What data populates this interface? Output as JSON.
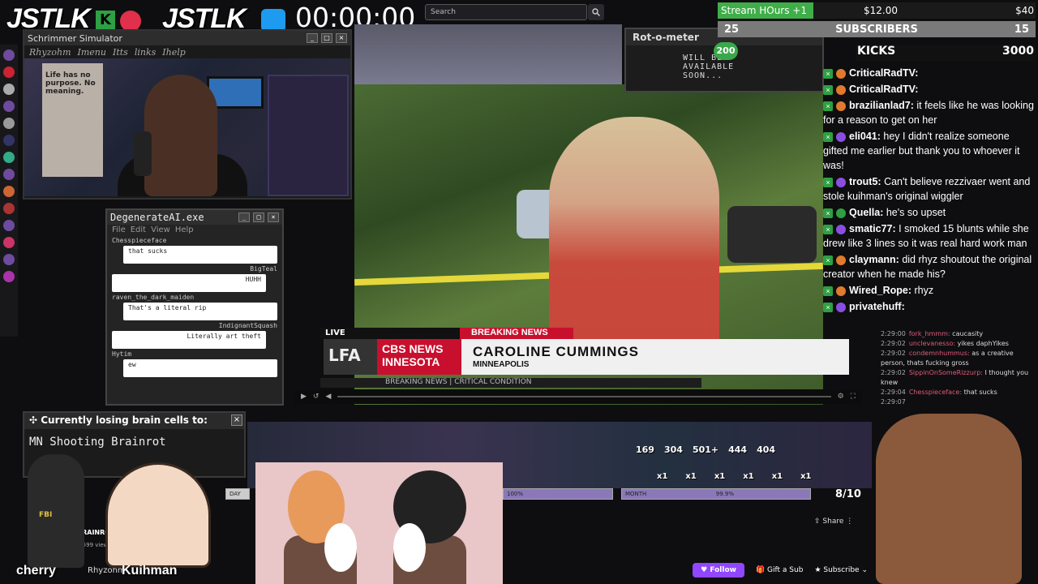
{
  "header": {
    "logo_left": "JSTLK",
    "logo_right": "JSTLK_",
    "timer": "00:00:00",
    "search_placeholder": "Search"
  },
  "goals": {
    "stream_hours_label": "Stream HOurs +1",
    "stream_hours_current": "$12.00",
    "stream_hours_target": "$40",
    "stream_hours_fraction": 0.3,
    "subs_current": "25",
    "subs_label": "SUBSCRIBERS",
    "subs_target": "15",
    "kicks_label": "KICKS",
    "kicks_value": "3000"
  },
  "rot_meter": {
    "title": "Rot-o-meter",
    "message": "WILL BE AVAILABLE SOON...",
    "badge": "200"
  },
  "webcam_window": {
    "title": "Schrimmer Simulator",
    "menu": [
      "Rhyzohm",
      "Imenu",
      "Itts",
      "links",
      "Ihelp"
    ],
    "poster_text": "Life has no purpose. No meaning."
  },
  "chat": [
    {
      "user": "CriticalRadTV:",
      "text": "",
      "color": "#e07a2c"
    },
    {
      "user": "CriticalRadTV:",
      "text": "",
      "color": "#e07a2c"
    },
    {
      "user": "brazilianlad7:",
      "text": "it feels like he was looking for a reason to get on her",
      "color": "#e07a2c"
    },
    {
      "user": "eli041:",
      "text": "hey I didn't realize someone gifted me earlier but thank you to whoever it was!",
      "color": "#8a4fe0"
    },
    {
      "user": "trout5:",
      "text": "Can't believe rezzivaer went and stole kuihman's original wiggler",
      "color": "#8a4fe0"
    },
    {
      "user": "Quella:",
      "text": "he's so upset",
      "color": "#2ea043"
    },
    {
      "user": "smatic77:",
      "text": "I smoked 15 blunts while she drew like 3 lines so it was real hard work man",
      "color": "#8a4fe0"
    },
    {
      "user": "claymann:",
      "text": "did rhyz shoutout the original creator when he made his?",
      "color": "#e07a2c"
    },
    {
      "user": "Wired_Rope:",
      "text": "rhyz",
      "color": "#e07a2c"
    },
    {
      "user": "privatehuff:",
      "text": "",
      "color": "#8a4fe0"
    }
  ],
  "mini_chat": [
    {
      "time": "2:29:00",
      "user": "fork_hmmm:",
      "text": "caucasity"
    },
    {
      "time": "2:29:02",
      "user": "unclevanesso:",
      "text": "yikes daphYikes"
    },
    {
      "time": "2:29:02",
      "user": "condemnhummus:",
      "text": "as a creative person, thats fucking gross"
    },
    {
      "time": "2:29:02",
      "user": "SippinOnSomeRizzurp:",
      "text": "I thought you knew"
    },
    {
      "time": "2:29:04",
      "user": "Chesspieceface:",
      "text": "that sucks"
    },
    {
      "time": "2:29:07",
      "user": "",
      "text": ""
    }
  ],
  "news": {
    "live": "LIVE",
    "breaking": "BREAKING NEWS",
    "network": "CBS NEWS",
    "region": "INNESOTA",
    "name": "CAROLINE CUMMINGS",
    "location": "MINNEAPOLIS",
    "ticker_left": "BREAKING NEWS",
    "ticker_right": "CRITICAL CONDITION",
    "network_badge": "LFA"
  },
  "degenerate": {
    "title": "DegenerateAI.exe",
    "menu": [
      "File",
      "Edit",
      "View",
      "Help"
    ],
    "messages": [
      {
        "user": "Chesspieceface",
        "text": "that sucks",
        "side": "left"
      },
      {
        "user": "BigTeal",
        "text": "HUHH",
        "side": "right"
      },
      {
        "user": "raven_the_dark_maiden",
        "text": "That's a literal rip",
        "side": "left"
      },
      {
        "user": "IndignantSquash",
        "text": "Literally art theft",
        "side": "right"
      },
      {
        "user": "Hytim",
        "text": "ew",
        "side": "left"
      }
    ]
  },
  "brain_cells": {
    "title": "Currently losing brain cells to:",
    "value": "MN Shooting Brainrot"
  },
  "stats": {
    "counts": [
      "169",
      "304",
      "501+",
      "444",
      "404"
    ],
    "multipliers": [
      "x1",
      "x1",
      "x1",
      "x1",
      "x1",
      "x1"
    ],
    "day_label": "DAY",
    "month_label": "MONTH",
    "month_value": "99.9%",
    "progress_value": "100%",
    "score": "8/10"
  },
  "page": {
    "brainrot_label": "BRAINROT",
    "views": "5,599 views",
    "channel": "Rhyzohm"
  },
  "captions": {
    "left": "cherry",
    "right": "Kuihman",
    "fbi": "FBI"
  },
  "actions": {
    "follow": "Follow",
    "gift": "Gift a Sub",
    "subscribe": "Subscribe",
    "share": "Share"
  }
}
